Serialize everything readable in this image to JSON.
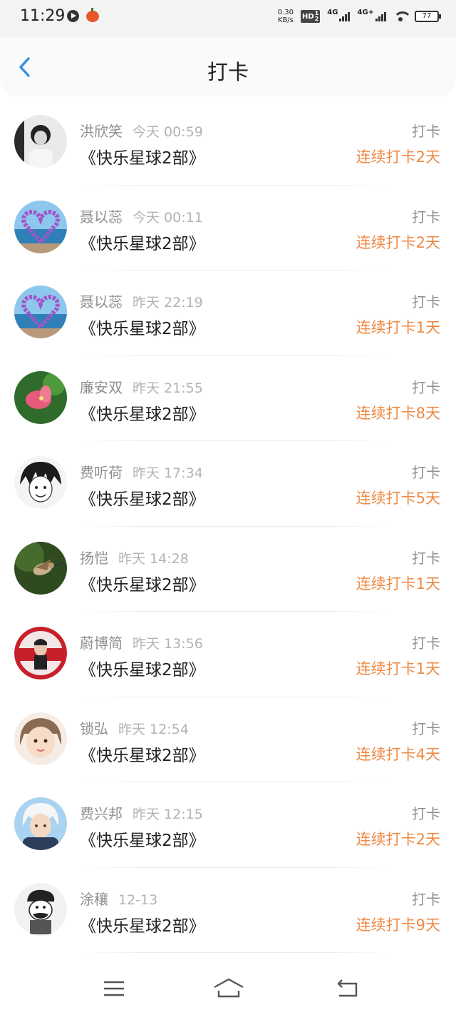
{
  "status_bar": {
    "time": "11:29",
    "net_speed_value": "0.30",
    "net_speed_unit": "KB/s",
    "hd_label": "HD",
    "sim1_label": "1",
    "sim2_label": "2",
    "net1": "4G",
    "net2": "4G+",
    "battery": "77"
  },
  "header": {
    "back_icon": "chevron-left-icon",
    "title": "打卡"
  },
  "colors": {
    "accent_blue": "#3a8ee6",
    "streak_orange": "#ee8a44"
  },
  "entries": [
    {
      "name": "洪欣笑",
      "time": "今天 00:59",
      "book": "《快乐星球2部》",
      "action": "打卡",
      "streak": "连续打卡2天"
    },
    {
      "name": "聂以蕊",
      "time": "今天 00:11",
      "book": "《快乐星球2部》",
      "action": "打卡",
      "streak": "连续打卡2天"
    },
    {
      "name": "聂以蕊",
      "time": "昨天 22:19",
      "book": "《快乐星球2部》",
      "action": "打卡",
      "streak": "连续打卡1天"
    },
    {
      "name": "廉安双",
      "time": "昨天 21:55",
      "book": "《快乐星球2部》",
      "action": "打卡",
      "streak": "连续打卡8天"
    },
    {
      "name": "费听荷",
      "time": "昨天 17:34",
      "book": "《快乐星球2部》",
      "action": "打卡",
      "streak": "连续打卡5天"
    },
    {
      "name": "扬恺",
      "time": "昨天 14:28",
      "book": "《快乐星球2部》",
      "action": "打卡",
      "streak": "连续打卡1天"
    },
    {
      "name": "蔚博简",
      "time": "昨天 13:56",
      "book": "《快乐星球2部》",
      "action": "打卡",
      "streak": "连续打卡1天"
    },
    {
      "name": "锁弘",
      "time": "昨天 12:54",
      "book": "《快乐星球2部》",
      "action": "打卡",
      "streak": "连续打卡4天"
    },
    {
      "name": "费兴邦",
      "time": "昨天 12:15",
      "book": "《快乐星球2部》",
      "action": "打卡",
      "streak": "连续打卡2天"
    },
    {
      "name": "涂穰",
      "time": "12-13",
      "book": "《快乐星球2部》",
      "action": "打卡",
      "streak": "连续打卡9天"
    }
  ],
  "nav": {
    "menu_icon": "menu-icon",
    "home_icon": "home-icon",
    "back_icon": "back-icon"
  }
}
